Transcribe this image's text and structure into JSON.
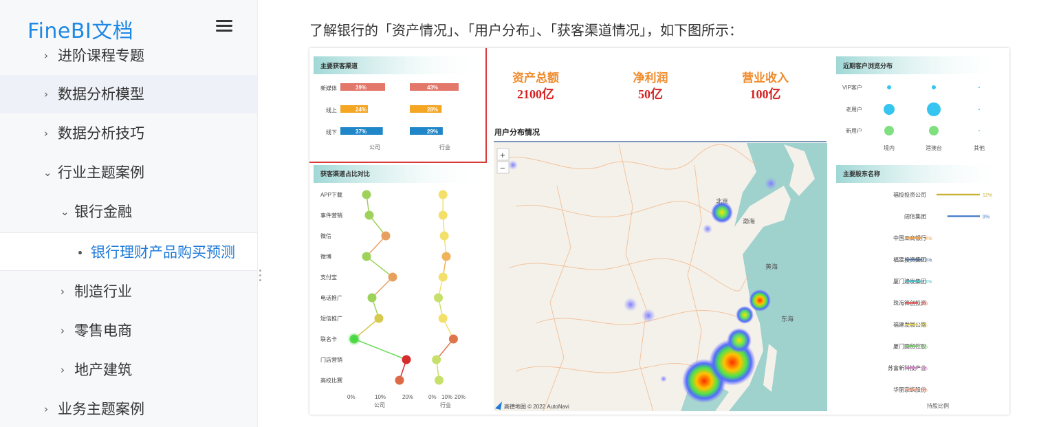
{
  "sidebar": {
    "logo": "FineBI文档",
    "items": [
      {
        "label": "进阶课程专题",
        "level": 1,
        "expanded": false
      },
      {
        "label": "数据分析模型",
        "level": 1,
        "expanded": false
      },
      {
        "label": "数据分析技巧",
        "level": 1,
        "expanded": false
      },
      {
        "label": "行业主题案例",
        "level": 1,
        "expanded": true
      },
      {
        "label": "银行金融",
        "level": 2,
        "expanded": true
      },
      {
        "label": "银行理财产品购买预测",
        "level": 3
      },
      {
        "label": "制造行业",
        "level": 2,
        "expanded": false
      },
      {
        "label": "零售电商",
        "level": 2,
        "expanded": false
      },
      {
        "label": "地产建筑",
        "level": 2,
        "expanded": false
      },
      {
        "label": "业务主题案例",
        "level": 1,
        "expanded": false
      }
    ]
  },
  "content": {
    "intro": "了解银行的「资产情况」、「用户分布」、「获客渠道情况」，如下图所示："
  },
  "dashboard": {
    "channels": {
      "title": "主要获客渠道",
      "rows": [
        {
          "name": "新媒体",
          "company": "39%",
          "industry": "43%",
          "color": "#e2776a"
        },
        {
          "name": "线上",
          "company": "24%",
          "industry": "28%",
          "color": "#f5a623"
        },
        {
          "name": "线下",
          "company": "37%",
          "industry": "29%",
          "color": "#1f86c8"
        }
      ],
      "col_company": "公司",
      "col_industry": "行业"
    },
    "kpis": [
      {
        "label": "资产总额",
        "value": "2100亿"
      },
      {
        "label": "净利润",
        "value": "50亿"
      },
      {
        "label": "营业收入",
        "value": "100亿"
      }
    ],
    "ratio": {
      "title": "获客渠道占比对比",
      "categories": [
        "APP下载",
        "事件营销",
        "微信",
        "微博",
        "支付宝",
        "电话推广",
        "短信推广",
        "联名卡",
        "门店营销",
        "高校比赛"
      ],
      "company": [
        5.5,
        6.5,
        12.5,
        5.5,
        15,
        7.5,
        10,
        1,
        20,
        17.5
      ],
      "industry": [
        8,
        8,
        9,
        10.5,
        8,
        4.5,
        8,
        16,
        3,
        5
      ],
      "xticks": [
        "0%",
        "10%",
        "20%"
      ],
      "label_company": "公司",
      "label_industry": "行业"
    },
    "map": {
      "title": "用户分布情况",
      "zoom_in": "+",
      "zoom_out": "−",
      "labels": [
        "北京",
        "渤海",
        "黄海",
        "东海"
      ],
      "credit": "高德地图 © 2022 AutoNavi"
    },
    "browse": {
      "title": "近期客户浏览分布",
      "rows": [
        "VIP客户",
        "老用户",
        "新用户"
      ],
      "cols": [
        "境内",
        "港澳台",
        "其他"
      ],
      "colors": [
        "#36c5f0",
        "#36c5f0",
        "#7ee07e"
      ],
      "size_labels": [
        [
          3,
          3,
          1
        ],
        [
          8,
          10,
          1
        ],
        [
          7,
          7,
          1
        ]
      ]
    },
    "holders": {
      "title": "主要股东名称",
      "axis_label": "持股比例",
      "rows": [
        {
          "name": "福投投资公司",
          "pct": "12%",
          "value": 12,
          "color": "#c9b33a"
        },
        {
          "name": "阔信集团",
          "pct": "9%",
          "value": 9,
          "color": "#4a7fc9"
        },
        {
          "name": "中国工商银行",
          "pct": "4%",
          "value": 4,
          "color": "#f0a24a"
        },
        {
          "name": "福建投资集团",
          "pct": "4%",
          "value": 4,
          "color": "#50709a"
        },
        {
          "name": "厦门建发集团",
          "pct": "4%",
          "value": 4,
          "color": "#58c4cf"
        },
        {
          "name": "珠海铧创投资",
          "pct": "3%",
          "value": 3,
          "color": "#e05555"
        },
        {
          "name": "福建发展公路",
          "pct": "3%",
          "value": 3,
          "color": "#e6d65a"
        },
        {
          "name": "厦门国贸控股",
          "pct": "3%",
          "value": 3,
          "color": "#7cc86e"
        },
        {
          "name": "苏富新科技产业",
          "pct": "3%",
          "value": 3,
          "color": "#d881c8"
        },
        {
          "name": "华丽家族股份",
          "pct": "3%",
          "value": 3,
          "color": "#f2a48a"
        }
      ]
    }
  }
}
